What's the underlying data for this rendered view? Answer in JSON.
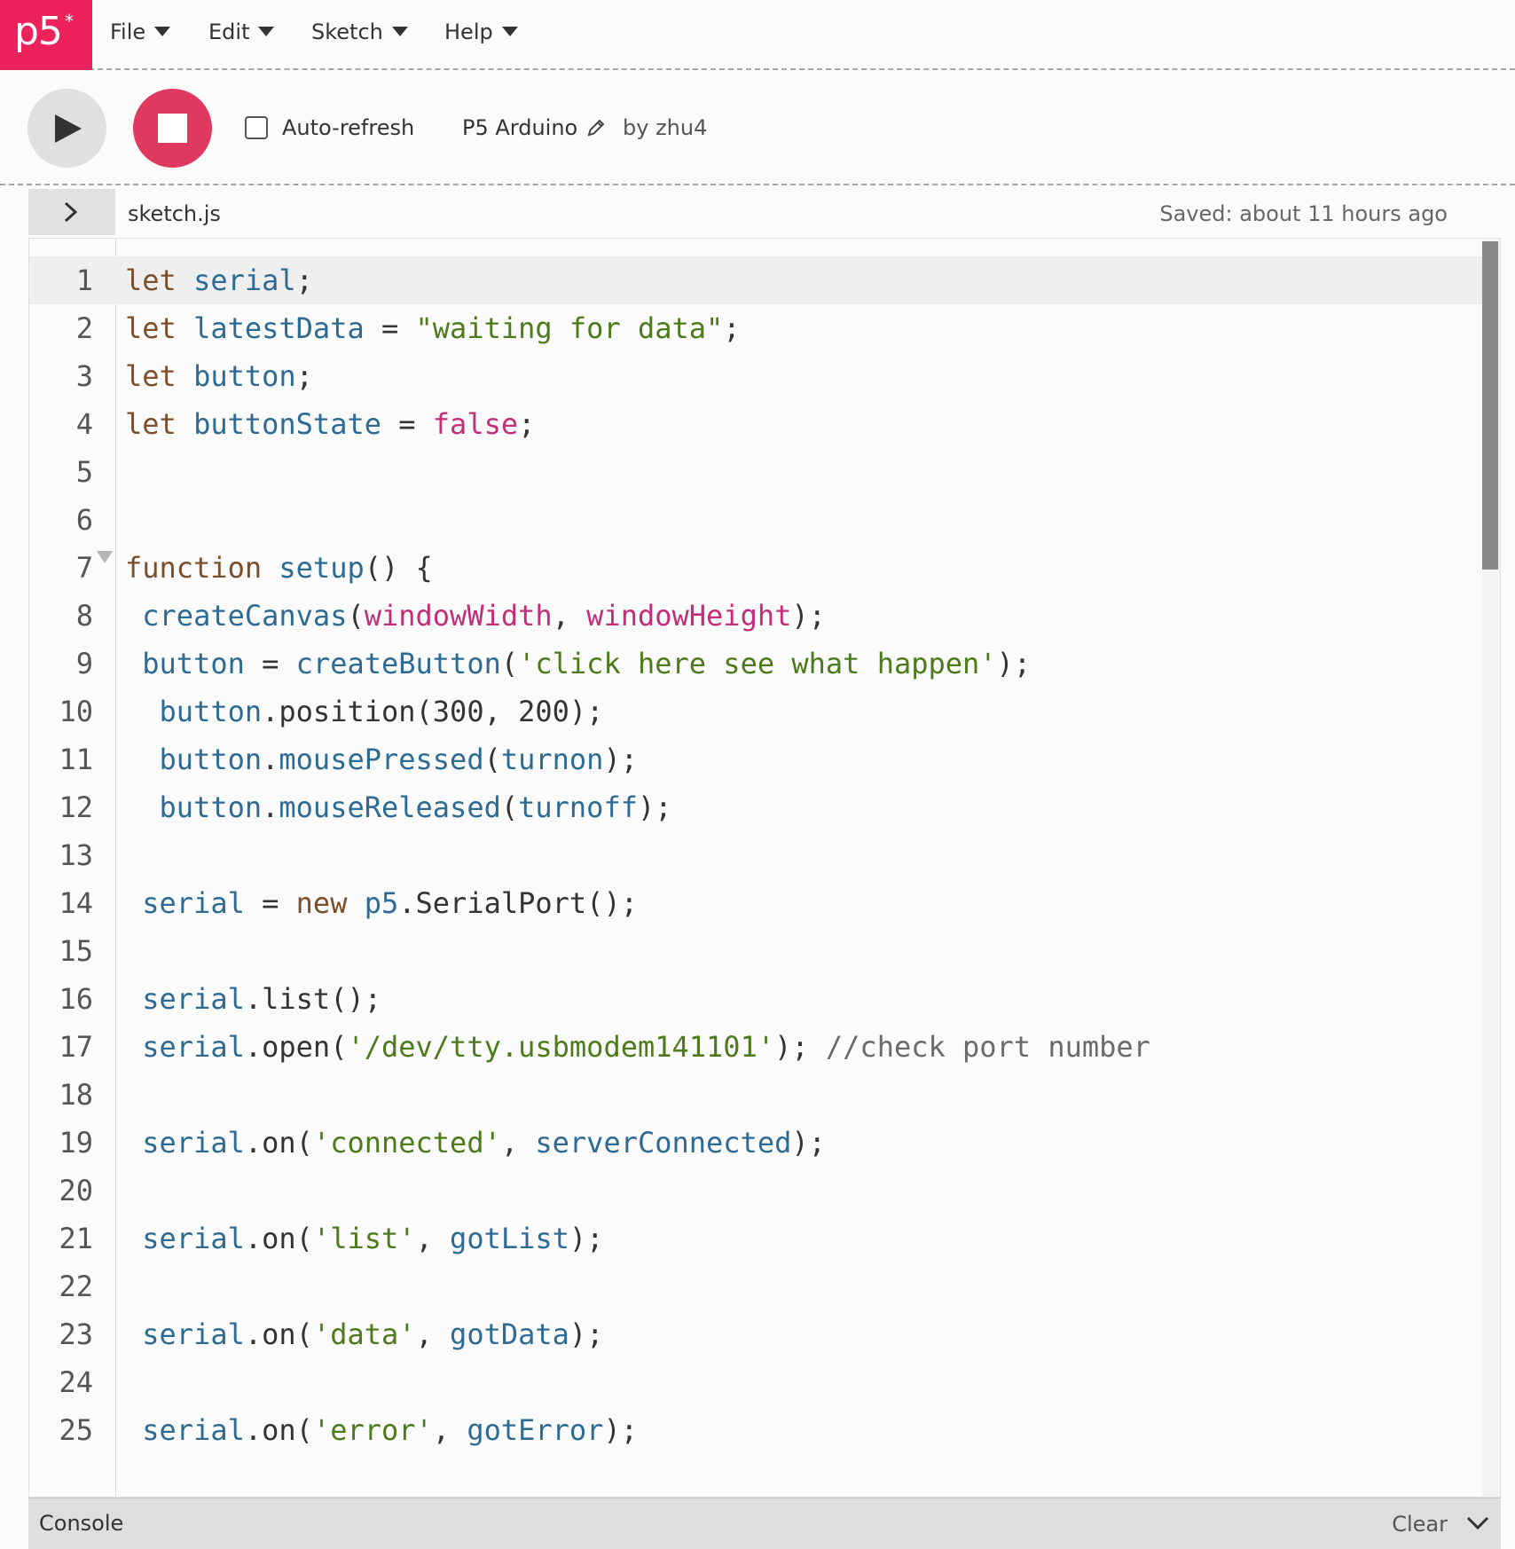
{
  "nav": {
    "logo_text": "p5",
    "logo_star": "*",
    "menus": [
      "File",
      "Edit",
      "Sketch",
      "Help"
    ]
  },
  "toolbar": {
    "play_icon": "play-icon",
    "stop_icon": "stop-icon",
    "auto_refresh_label": "Auto-refresh",
    "auto_refresh_checked": false,
    "project_name": "P5 Arduino",
    "owner": "by zhu4"
  },
  "file_tab": {
    "filename": "sketch.js",
    "saved_status": "Saved: about 11 hours ago"
  },
  "editor": {
    "language": "javascript",
    "active_line": 1,
    "lines": [
      {
        "n": "1",
        "tokens": [
          [
            "kw",
            "let"
          ],
          [
            "plain",
            " "
          ],
          [
            "var",
            "serial"
          ],
          [
            "plain",
            ";"
          ]
        ]
      },
      {
        "n": "2",
        "tokens": [
          [
            "kw",
            "let"
          ],
          [
            "plain",
            " "
          ],
          [
            "var",
            "latestData"
          ],
          [
            "plain",
            " = "
          ],
          [
            "str",
            "\"waiting for data\""
          ],
          [
            "plain",
            ";"
          ]
        ]
      },
      {
        "n": "3",
        "tokens": [
          [
            "kw",
            "let"
          ],
          [
            "plain",
            " "
          ],
          [
            "var",
            "button"
          ],
          [
            "plain",
            ";"
          ]
        ]
      },
      {
        "n": "4",
        "tokens": [
          [
            "kw",
            "let"
          ],
          [
            "plain",
            " "
          ],
          [
            "var",
            "buttonState"
          ],
          [
            "plain",
            " = "
          ],
          [
            "atom",
            "false"
          ],
          [
            "plain",
            ";"
          ]
        ]
      },
      {
        "n": "5",
        "tokens": []
      },
      {
        "n": "6",
        "tokens": []
      },
      {
        "n": "7",
        "fold": true,
        "tokens": [
          [
            "kw",
            "function"
          ],
          [
            "plain",
            " "
          ],
          [
            "var",
            "setup"
          ],
          [
            "plain",
            "() {"
          ]
        ]
      },
      {
        "n": "8",
        "tokens": [
          [
            "plain",
            " "
          ],
          [
            "var",
            "createCanvas"
          ],
          [
            "plain",
            "("
          ],
          [
            "atom",
            "windowWidth"
          ],
          [
            "plain",
            ", "
          ],
          [
            "atom",
            "windowHeight"
          ],
          [
            "plain",
            ");"
          ]
        ]
      },
      {
        "n": "9",
        "tokens": [
          [
            "plain",
            " "
          ],
          [
            "var",
            "button"
          ],
          [
            "plain",
            " = "
          ],
          [
            "var",
            "createButton"
          ],
          [
            "plain",
            "("
          ],
          [
            "str",
            "'click here see what happen'"
          ],
          [
            "plain",
            ");"
          ]
        ]
      },
      {
        "n": "10",
        "tokens": [
          [
            "plain",
            "  "
          ],
          [
            "var",
            "button"
          ],
          [
            "plain",
            ".position(300, 200);"
          ]
        ]
      },
      {
        "n": "11",
        "tokens": [
          [
            "plain",
            "  "
          ],
          [
            "var",
            "button"
          ],
          [
            "plain",
            "."
          ],
          [
            "var",
            "mousePressed"
          ],
          [
            "plain",
            "("
          ],
          [
            "var",
            "turnon"
          ],
          [
            "plain",
            ");"
          ]
        ]
      },
      {
        "n": "12",
        "tokens": [
          [
            "plain",
            "  "
          ],
          [
            "var",
            "button"
          ],
          [
            "plain",
            "."
          ],
          [
            "var",
            "mouseReleased"
          ],
          [
            "plain",
            "("
          ],
          [
            "var",
            "turnoff"
          ],
          [
            "plain",
            ");"
          ]
        ]
      },
      {
        "n": "13",
        "tokens": []
      },
      {
        "n": "14",
        "tokens": [
          [
            "plain",
            " "
          ],
          [
            "var",
            "serial"
          ],
          [
            "plain",
            " = "
          ],
          [
            "kw",
            "new"
          ],
          [
            "plain",
            " "
          ],
          [
            "var",
            "p5"
          ],
          [
            "plain",
            ".SerialPort();"
          ]
        ]
      },
      {
        "n": "15",
        "tokens": []
      },
      {
        "n": "16",
        "tokens": [
          [
            "plain",
            " "
          ],
          [
            "var",
            "serial"
          ],
          [
            "plain",
            ".list();"
          ]
        ]
      },
      {
        "n": "17",
        "tokens": [
          [
            "plain",
            " "
          ],
          [
            "var",
            "serial"
          ],
          [
            "plain",
            ".open("
          ],
          [
            "str",
            "'/dev/tty.usbmodem141101'"
          ],
          [
            "plain",
            "); "
          ],
          [
            "comment",
            "//check port number"
          ]
        ]
      },
      {
        "n": "18",
        "tokens": []
      },
      {
        "n": "19",
        "tokens": [
          [
            "plain",
            " "
          ],
          [
            "var",
            "serial"
          ],
          [
            "plain",
            ".on("
          ],
          [
            "str",
            "'connected'"
          ],
          [
            "plain",
            ", "
          ],
          [
            "var",
            "serverConnected"
          ],
          [
            "plain",
            ");"
          ]
        ]
      },
      {
        "n": "20",
        "tokens": []
      },
      {
        "n": "21",
        "tokens": [
          [
            "plain",
            " "
          ],
          [
            "var",
            "serial"
          ],
          [
            "plain",
            ".on("
          ],
          [
            "str",
            "'list'"
          ],
          [
            "plain",
            ", "
          ],
          [
            "var",
            "gotList"
          ],
          [
            "plain",
            ");"
          ]
        ]
      },
      {
        "n": "22",
        "tokens": []
      },
      {
        "n": "23",
        "tokens": [
          [
            "plain",
            " "
          ],
          [
            "var",
            "serial"
          ],
          [
            "plain",
            ".on("
          ],
          [
            "str",
            "'data'"
          ],
          [
            "plain",
            ", "
          ],
          [
            "var",
            "gotData"
          ],
          [
            "plain",
            ");"
          ]
        ]
      },
      {
        "n": "24",
        "tokens": []
      },
      {
        "n": "25",
        "tokens": [
          [
            "plain",
            " "
          ],
          [
            "var",
            "serial"
          ],
          [
            "plain",
            ".on("
          ],
          [
            "str",
            "'error'"
          ],
          [
            "plain",
            ", "
          ],
          [
            "var",
            "gotError"
          ],
          [
            "plain",
            ");"
          ]
        ]
      }
    ]
  },
  "console": {
    "title": "Console",
    "clear_label": "Clear"
  },
  "colors": {
    "brand": "#ed225d",
    "stop_button": "#e0395f",
    "keyword": "#7a4f2a",
    "variable": "#2d6b95",
    "string": "#4d7a1b",
    "atom": "#c42e78"
  }
}
